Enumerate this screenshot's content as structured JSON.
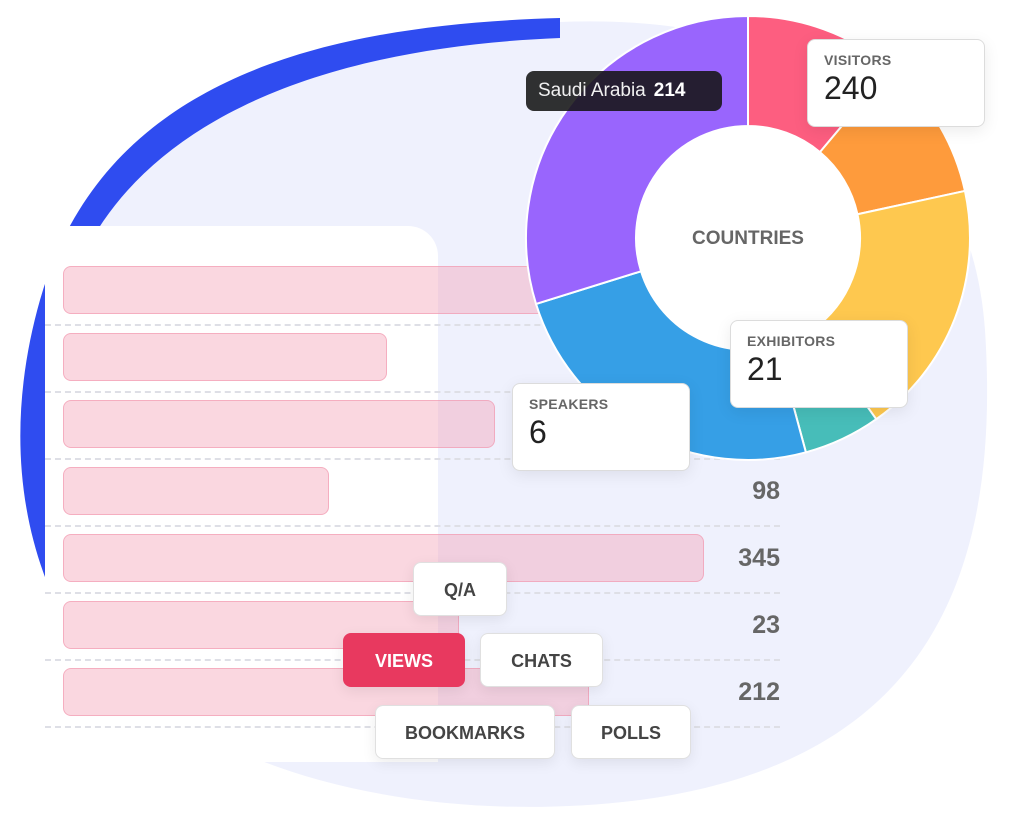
{
  "colors": {
    "accent_blue": "#2f4cf0",
    "blob_bg": "#eff1fd",
    "active_tag": "#e8395f",
    "bar_fill": "#f6d5dd"
  },
  "bars": {
    "rows": [
      {
        "value": null,
        "fill": 0.76
      },
      {
        "value": null,
        "fill": 0.45
      },
      {
        "value": null,
        "fill": 0.6
      },
      {
        "value": "98",
        "fill": 0.37
      },
      {
        "value": "345",
        "fill": 0.89
      },
      {
        "value": "23",
        "fill": 0.55
      },
      {
        "value": "212",
        "fill": 0.73
      }
    ]
  },
  "chart_data": {
    "type": "pie",
    "title": "COUNTRIES",
    "slices": [
      {
        "name": "slice-pink",
        "color": "#fd5e80",
        "share": 0.111
      },
      {
        "name": "slice-orange",
        "color": "#fe9b3c",
        "share": 0.105
      },
      {
        "name": "slice-yellow",
        "color": "#fec84f",
        "share": 0.186
      },
      {
        "name": "slice-teal",
        "color": "#47bdb9",
        "share": 0.056
      },
      {
        "name": "slice-blue",
        "color": "#369fe6",
        "share": 0.244
      },
      {
        "name": "slice-purple",
        "color": "#9965fd",
        "share": 0.298
      }
    ],
    "tooltip": {
      "label": "Saudi Arabia",
      "value": "214"
    }
  },
  "center_label": "COUNTRIES",
  "stats": [
    {
      "label": "VISITORS",
      "value": "240"
    },
    {
      "label": "EXHIBITORS",
      "value": "21"
    },
    {
      "label": "SPEAKERS",
      "value": "6"
    }
  ],
  "tags": [
    {
      "label": "Q/A",
      "active": false
    },
    {
      "label": "VIEWS",
      "active": true
    },
    {
      "label": "CHATS",
      "active": false
    },
    {
      "label": "BOOKMARKS",
      "active": false
    },
    {
      "label": "POLLS",
      "active": false
    }
  ]
}
